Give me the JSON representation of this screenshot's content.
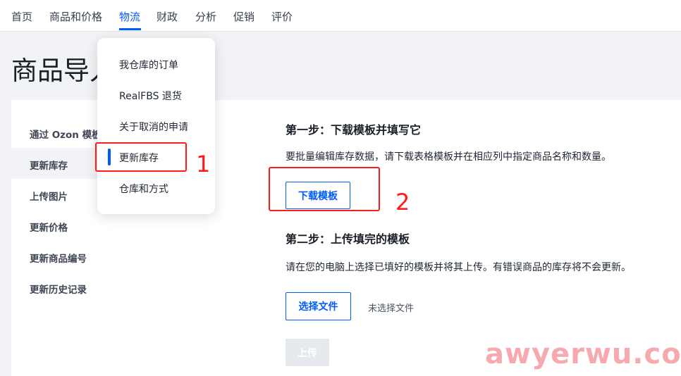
{
  "nav": {
    "items": [
      "首页",
      "商品和价格",
      "物流",
      "财政",
      "分析",
      "促销",
      "评价"
    ],
    "active": "物流"
  },
  "page": {
    "title": "商品导入"
  },
  "sidebar": {
    "items": [
      {
        "label": "通过 Ozon 模板"
      },
      {
        "label": "更新库存"
      },
      {
        "label": "上传图片"
      },
      {
        "label": "更新价格"
      },
      {
        "label": "更新商品编号"
      },
      {
        "label": "更新历史记录"
      }
    ],
    "selected": "更新库存"
  },
  "step1": {
    "title": "第一步：下载模板并填写它",
    "desc": "要批量编辑库存数据，请下载表格模板并在相应列中指定商品名称和数量。",
    "button": "下载模板"
  },
  "step2": {
    "title": "第二步：上传填完的模板",
    "desc": "请在您的电脑上选择已填好的模板并将其上传。有错误商品的库存将不会更新。",
    "choose_button": "选择文件",
    "no_file": "未选择文件",
    "upload_button": "上传"
  },
  "dropdown": {
    "items": [
      "我仓库的订单",
      "RealFBS 退货",
      "关于取消的申请",
      "更新库存",
      "仓库和方式"
    ],
    "highlighted": "更新库存"
  },
  "annotations": {
    "one": "1",
    "two": "2"
  },
  "watermark": "awyerwu.com",
  "colors": {
    "accent": "#005bff",
    "annotation": "#ff1a1a",
    "watermark": "#f59ba0"
  }
}
